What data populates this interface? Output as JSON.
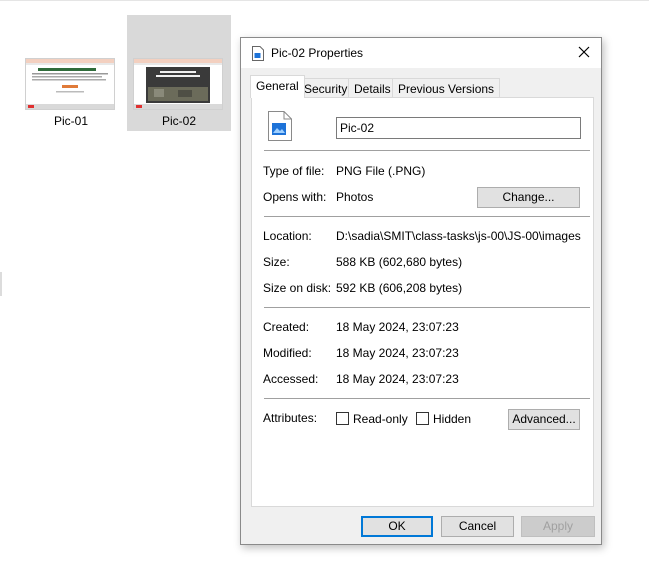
{
  "explorer": {
    "files": [
      {
        "name": "Pic-01",
        "selected": false
      },
      {
        "name": "Pic-02",
        "selected": true
      }
    ]
  },
  "dialog": {
    "title": "Pic-02 Properties",
    "tabs": [
      "General",
      "Security",
      "Details",
      "Previous Versions"
    ],
    "active_tab": "General",
    "file_name_value": "Pic-02",
    "type_label": "Type of file:",
    "type_value": "PNG File (.PNG)",
    "opens_label": "Opens with:",
    "opens_value": "Photos",
    "change_button": "Change...",
    "location_label": "Location:",
    "location_value": "D:\\sadia\\SMIT\\class-tasks\\js-00\\JS-00\\images",
    "size_label": "Size:",
    "size_value": "588 KB (602,680 bytes)",
    "size_on_disk_label": "Size on disk:",
    "size_on_disk_value": "592 KB (606,208 bytes)",
    "created_label": "Created:",
    "created_value": "18 May 2024, 23:07:23",
    "modified_label": "Modified:",
    "modified_value": "18 May 2024, 23:07:23",
    "accessed_label": "Accessed:",
    "accessed_value": "18 May 2024, 23:07:23",
    "attributes_label": "Attributes:",
    "readonly_label": "Read-only",
    "readonly_checked": false,
    "hidden_label": "Hidden",
    "hidden_checked": false,
    "advanced_button": "Advanced...",
    "ok_button": "OK",
    "cancel_button": "Cancel",
    "apply_button": "Apply",
    "apply_enabled": false
  },
  "colors": {
    "selection_bg": "#d9d9d9",
    "accent": "#0078d7",
    "dialog_bg": "#f0f0f0"
  }
}
